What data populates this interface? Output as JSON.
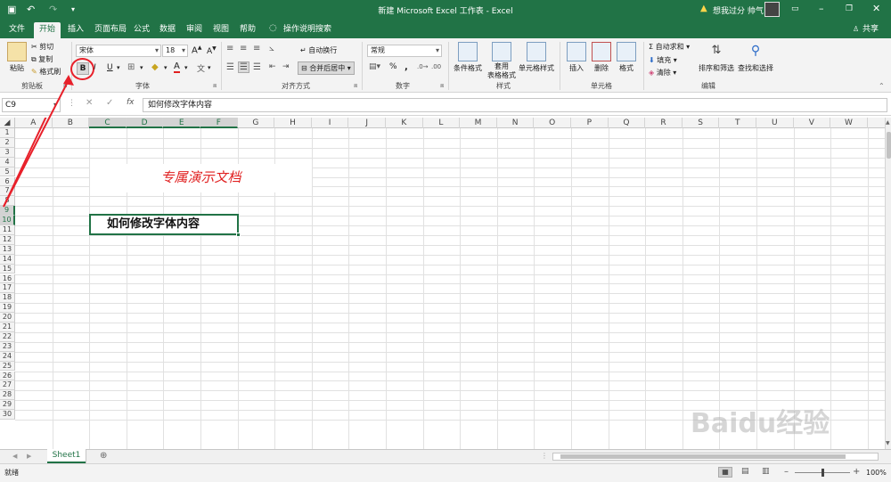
{
  "titlebar": {
    "title": "新建 Microsoft Excel 工作表 - Excel",
    "user": "想我过分 帅气",
    "warning_icon": "warning-icon"
  },
  "tabs": [
    "文件",
    "开始",
    "插入",
    "页面布局",
    "公式",
    "数据",
    "审阅",
    "视图",
    "帮助",
    "操作说明搜索"
  ],
  "share_label": "共享",
  "ribbon": {
    "clipboard": {
      "paste": "粘贴",
      "cut": "剪切",
      "copy": "复制",
      "format_painter": "格式刷",
      "label": "剪贴板"
    },
    "font": {
      "name": "宋体",
      "size": "18",
      "bold": "B",
      "italic": "I",
      "underline": "U",
      "label": "字体"
    },
    "alignment": {
      "wrap": "自动换行",
      "merge": "合并后居中",
      "label": "对齐方式"
    },
    "number": {
      "format": "常规",
      "percent": "%",
      "comma": ",",
      "label": "数字"
    },
    "styles": {
      "conditional": "条件格式",
      "table": "套用\n表格格式",
      "cell_styles": "单元格样式",
      "label": "样式"
    },
    "cells": {
      "insert": "插入",
      "delete": "删除",
      "format": "格式",
      "label": "单元格"
    },
    "editing": {
      "autosum": "自动求和",
      "fill": "填充",
      "clear": "清除",
      "sort": "排序和筛选",
      "find": "查找和选择",
      "label": "编辑"
    }
  },
  "formula_bar": {
    "name_box": "C9",
    "content": "如何修改字体内容",
    "fx": "fx"
  },
  "columns": [
    "A",
    "B",
    "C",
    "D",
    "E",
    "F",
    "G",
    "H",
    "I",
    "J",
    "K",
    "L",
    "M",
    "N",
    "O",
    "P",
    "Q",
    "R",
    "S",
    "T",
    "U",
    "V",
    "W"
  ],
  "rows": [
    "1",
    "2",
    "3",
    "4",
    "5",
    "6",
    "7",
    "8",
    "9",
    "10",
    "11",
    "12",
    "13",
    "14",
    "15",
    "16",
    "17",
    "18",
    "19",
    "20",
    "21",
    "22",
    "23",
    "24",
    "25",
    "26",
    "27",
    "28",
    "29",
    "30"
  ],
  "cells": {
    "title_text": "专属演示文档",
    "selected_text": "如何修改字体内容"
  },
  "sheet_tab": "Sheet1",
  "status": {
    "ready": "就绪",
    "zoom": "100%"
  },
  "watermark": "Baidu经验"
}
